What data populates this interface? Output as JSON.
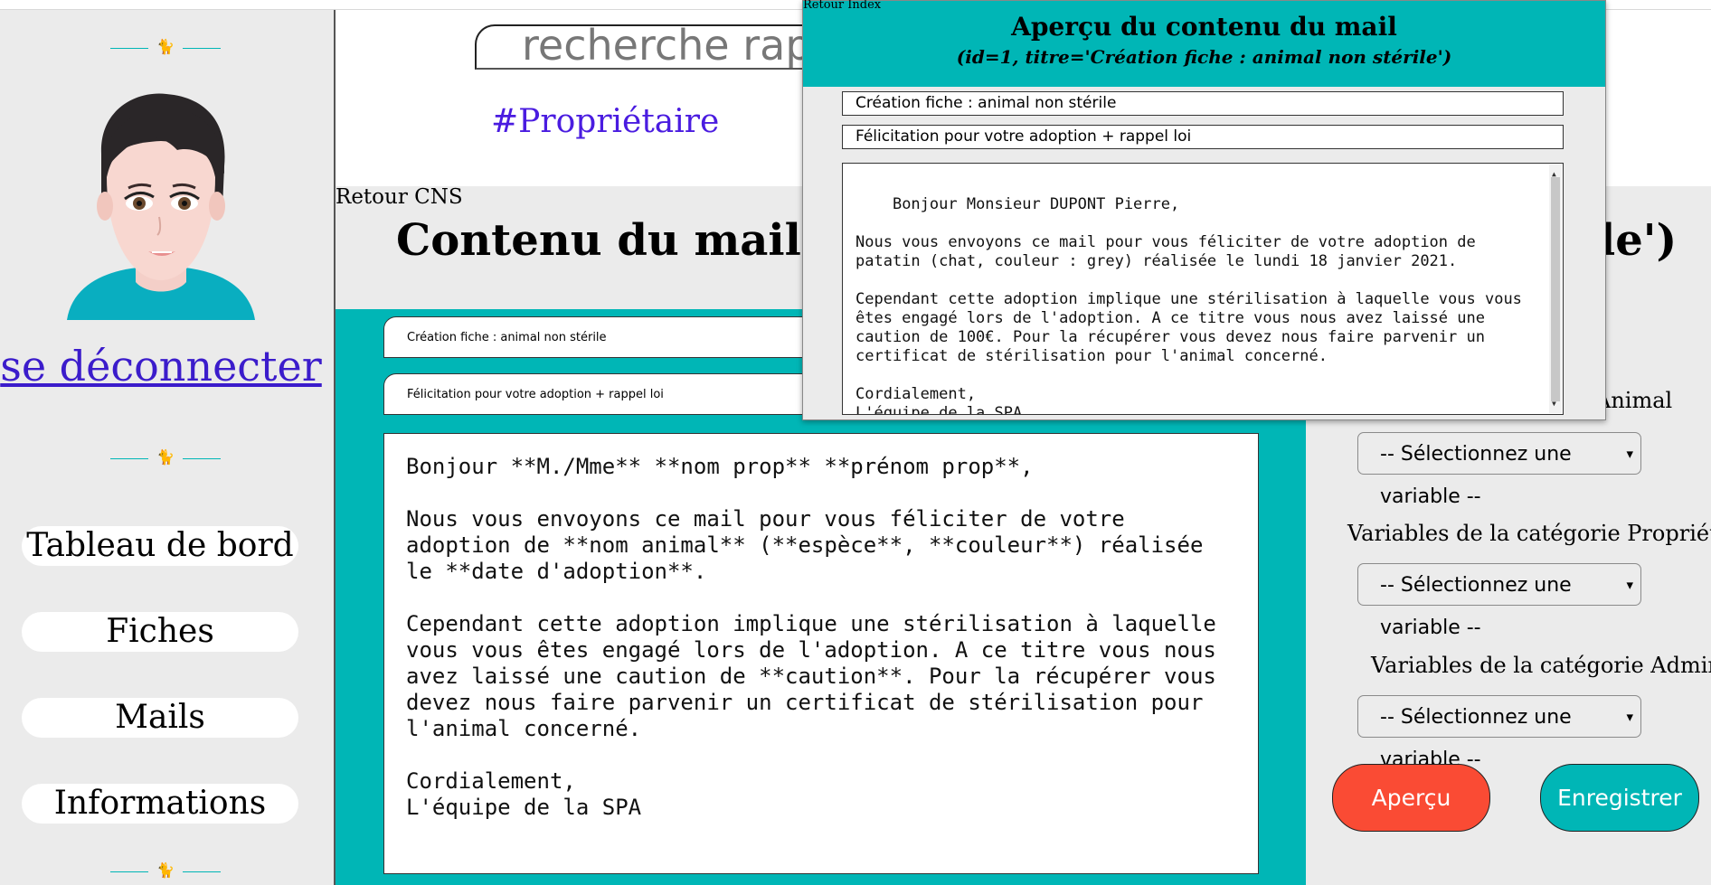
{
  "sidebar": {
    "logout": "se déconnecter",
    "nav": [
      "Tableau de bord",
      "Fiches",
      "Mails",
      "Informations"
    ]
  },
  "search": {
    "placeholder": "recherche rap"
  },
  "hashtag": "#Propriétaire",
  "main": {
    "back_link": "Retour CNS",
    "title": "Contenu du mail (id=",
    "title_tail": "le')",
    "subject": "Création fiche : animal non stérile",
    "object": "Félicitation pour votre adoption + rappel loi",
    "body": "Bonjour **M./Mme** **nom prop** **prénom prop**,\n\nNous vous envoyons ce mail pour vous féliciter de votre adoption de **nom animal** (**espèce**, **couleur**) réalisée le **date d'adoption**.\n\nCependant cette adoption implique une stérilisation à laquelle vous vous êtes engagé lors de l'adoption. A ce titre vous nous avez laissé une caution de **caution**. Pour la récupérer vous devez nous faire parvenir un certificat de stérilisation pour l'animal concerné.\n\nCordialement,\nL'équipe de la SPA"
  },
  "variables": {
    "animal_label": "Animal",
    "proprietaire_label": "Variables de la catégorie Propriétaire",
    "admin_label": "Variables de la catégorie Admin",
    "select_placeholder": "-- Sélectionnez une variable --"
  },
  "buttons": {
    "apercu": "Aperçu",
    "save": "Enregistrer"
  },
  "popup": {
    "back_link": "Retour Index",
    "title": "Aperçu du contenu du mail",
    "subtitle": "(id=1, titre='Création fiche : animal non stérile')",
    "subject": "Création fiche : animal non stérile",
    "object": "Félicitation pour votre adoption + rappel loi",
    "body": "Bonjour Monsieur DUPONT Pierre,\n\nNous vous envoyons ce mail pour vous féliciter de votre adoption de patatin (chat, couleur : grey) réalisée le lundi 18 janvier 2021.\n\nCependant cette adoption implique une stérilisation à laquelle vous vous êtes engagé lors de l'adoption. A ce titre vous nous avez laissé une caution de 100€. Pour la récupérer vous devez nous faire parvenir un certificat de stérilisation pour l'animal concerné.\n\nCordialement,\nL'équipe de la SPA"
  },
  "colors": {
    "teal": "#00b6b6",
    "red": "#fa4b34",
    "purple": "#4a1ce0",
    "panel": "#ebebeb"
  },
  "icons": [
    "cat-icon",
    "avatar-image",
    "chevron-down-icon",
    "resize-grip-icon"
  ]
}
